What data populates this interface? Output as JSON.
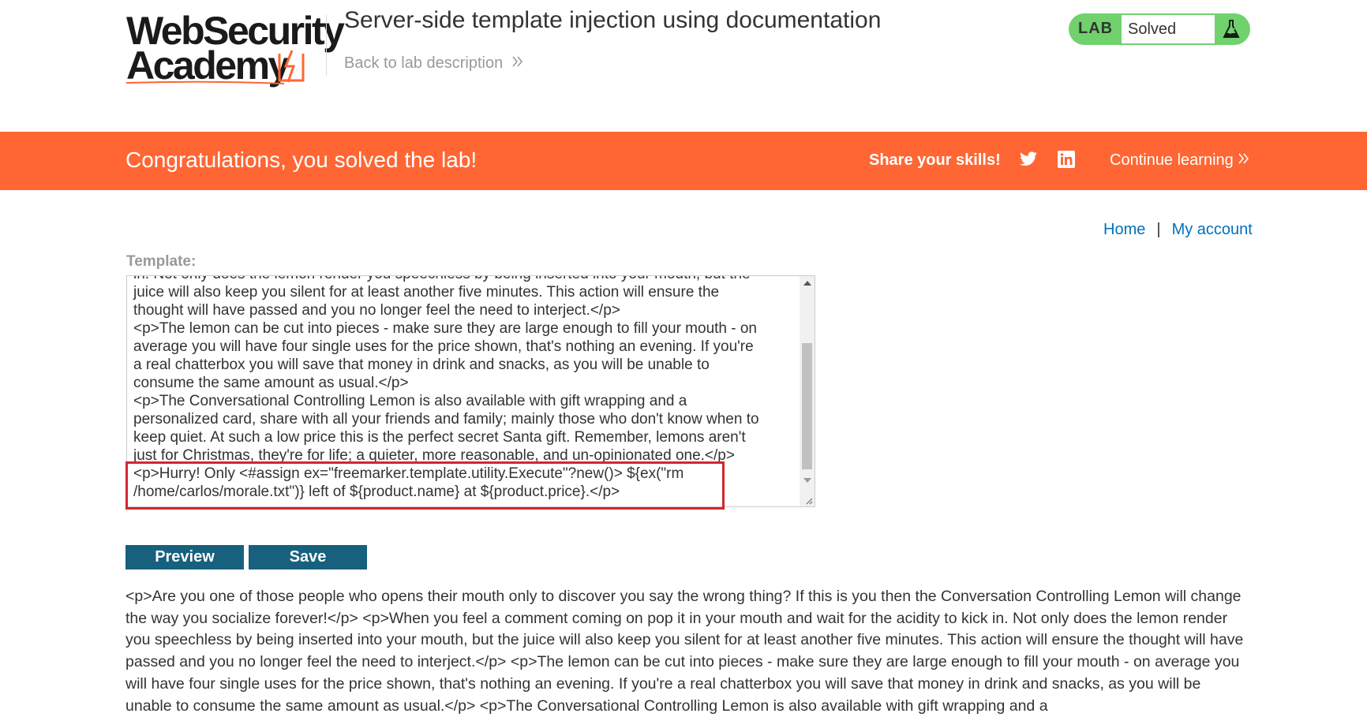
{
  "header": {
    "logo_line1": "WebSecurity",
    "logo_line2": "Academy",
    "lab_title": "Server-side template injection using documentation",
    "back_link": "Back to lab description",
    "badge_label": "LAB",
    "badge_status": "Solved"
  },
  "banner": {
    "message": "Congratulations, you solved the lab!",
    "share": "Share your skills!",
    "continue": "Continue learning"
  },
  "nav": {
    "home": "Home",
    "separator": "|",
    "account": "My account"
  },
  "template": {
    "label": "Template:",
    "text": "in. Not only does the lemon render you speechless by being inserted into your mouth, but the\njuice will also keep you silent for at least another five minutes. This action will ensure the\nthought will have passed and you no longer feel the need to interject.</p>\n<p>The lemon can be cut into pieces - make sure they are large enough to fill your mouth - on\naverage you will have four single uses for the price shown, that's nothing an evening. If you're\na real chatterbox you will save that money in drink and snacks, as you will be unable to\nconsume the same amount as usual.</p>\n<p>The Conversational Controlling Lemon is also available with gift wrapping and a\npersonalized card, share with all your friends and family; mainly those who don't know when to\nkeep quiet. At such a low price this is the perfect secret Santa gift. Remember, lemons aren't\njust for Christmas, they're for life; a quieter, more reasonable, and un-opinionated one.</p>\n<p>Hurry! Only <#assign ex=\"freemarker.template.utility.Execute\"?new()> ${ex(\"rm\n/home/carlos/morale.txt\")} left of ${product.name} at ${product.price}.</p>"
  },
  "buttons": {
    "preview": "Preview",
    "save": "Save"
  },
  "preview_output": "<p>Are you one of those people who opens their mouth only to discover you say the wrong thing? If this is you then the Conversation Controlling Lemon will change the way you socialize forever!</p> <p>When you feel a comment coming on pop it in your mouth and wait for the acidity to kick in. Not only does the lemon render you speechless by being inserted into your mouth, but the juice will also keep you silent for at least another five minutes. This action will ensure the thought will have passed and you no longer feel the need to interject.</p> <p>The lemon can be cut into pieces - make sure they are large enough to fill your mouth - on average you will have four single uses for the price shown, that's nothing an evening. If you're a real chatterbox you will save that money in drink and snacks, as you will be unable to consume the same amount as usual.</p> <p>The Conversational Controlling Lemon is also available with gift wrapping and a",
  "colors": {
    "banner": "#ff6633",
    "badge": "#70d16d",
    "button": "#17607e",
    "link": "#0071bc",
    "highlight": "#d3262c"
  },
  "icons": [
    "logo-lightning-icon",
    "chevron-right-icon",
    "flask-icon",
    "twitter-icon",
    "linkedin-icon",
    "scroll-up-arrow-icon",
    "scroll-down-arrow-icon",
    "resize-handle-icon"
  ]
}
